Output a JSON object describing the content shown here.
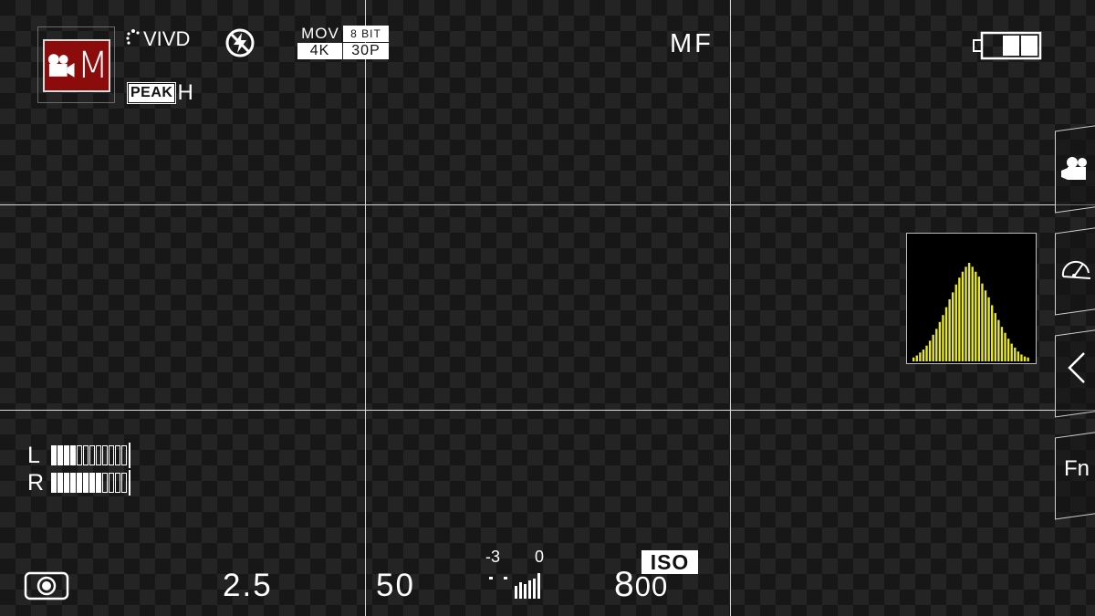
{
  "shooting_mode": {
    "letter": "M",
    "icon": "movie-camera-icon",
    "bg_color": "#8c0b0b"
  },
  "film_sim": {
    "label": "VIVD"
  },
  "flash": {
    "icon": "flash-off-icon"
  },
  "format": {
    "container": "MOV",
    "bit_depth": "8 BIT",
    "resolution": "4K",
    "frame_rate": "30P"
  },
  "peaking": {
    "label": "PEAK",
    "level": "H"
  },
  "focus_mode": "MF",
  "battery": {
    "bars_filled": 2,
    "bars_total": 3
  },
  "histogram": {
    "color": "#e8e82a",
    "values": [
      0.04,
      0.06,
      0.09,
      0.12,
      0.16,
      0.21,
      0.27,
      0.33,
      0.4,
      0.47,
      0.55,
      0.63,
      0.7,
      0.78,
      0.85,
      0.91,
      0.96,
      1.0,
      0.96,
      0.91,
      0.86,
      0.79,
      0.72,
      0.65,
      0.57,
      0.49,
      0.42,
      0.35,
      0.29,
      0.23,
      0.18,
      0.14,
      0.1,
      0.07,
      0.05,
      0.04
    ]
  },
  "side_menu": [
    {
      "icon": "movie-camera-icon"
    },
    {
      "icon": "stabilizer-gauge-icon"
    },
    {
      "icon": "chevron-left-icon"
    },
    {
      "label": "Fn"
    }
  ],
  "audio": {
    "left": {
      "label": "L",
      "level": 0.36,
      "segments": 12
    },
    "right": {
      "label": "R",
      "level": 0.64,
      "segments": 12
    }
  },
  "metering": {
    "icon": "spot-metering-icon"
  },
  "aperture": "2.5",
  "shutter": "50",
  "exposure": {
    "min_label": "-3",
    "zero_label": "0"
  },
  "iso": {
    "badge": "ISO",
    "value_main": "8",
    "value_tail": "00"
  }
}
